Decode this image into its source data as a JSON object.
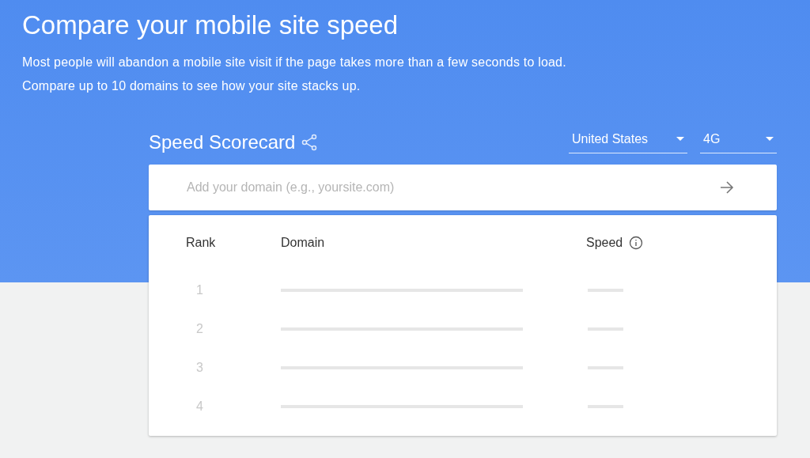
{
  "header": {
    "title": "Compare your mobile site speed",
    "description": "Most people will abandon a mobile site visit if the page takes more than a few seconds to load. Compare up to 10 domains to see how your site stacks up."
  },
  "scorecard": {
    "title": "Speed Scorecard",
    "country": "United States",
    "network": "4G"
  },
  "domain_input": {
    "placeholder": "Add your domain (e.g., yoursite.com)"
  },
  "table": {
    "columns": [
      "Rank",
      "Domain",
      "Speed"
    ],
    "rows": [
      {
        "rank": "1"
      },
      {
        "rank": "2"
      },
      {
        "rank": "3"
      },
      {
        "rank": "4"
      }
    ]
  }
}
